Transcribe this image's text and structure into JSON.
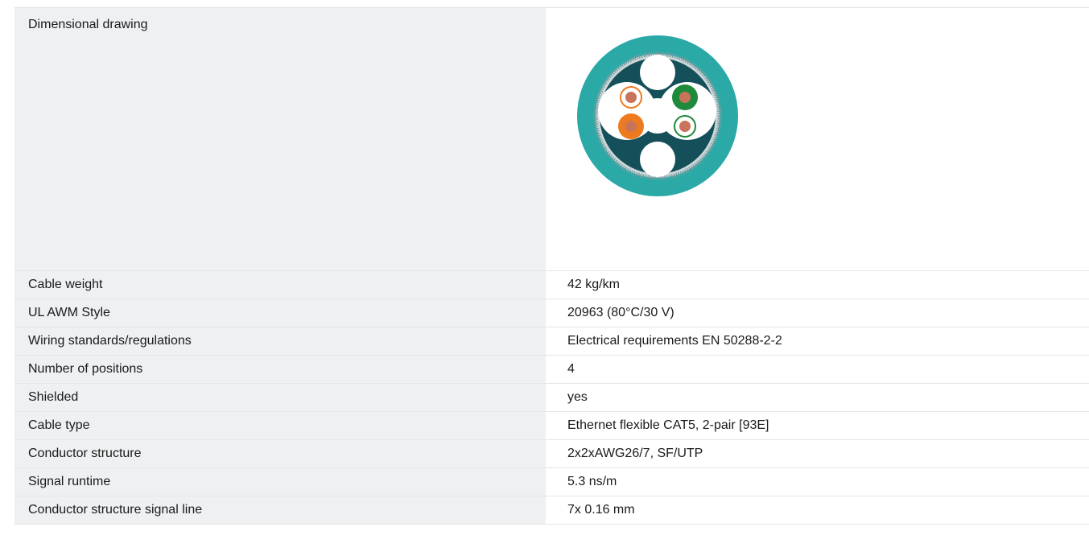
{
  "specs": {
    "drawing_label": "Dimensional drawing",
    "rows": [
      {
        "label": "Cable weight",
        "value": "42 kg/km"
      },
      {
        "label": "UL AWM Style",
        "value": "20963 (80°C/30 V)"
      },
      {
        "label": "Wiring standards/regulations",
        "value": "Electrical requirements EN 50288-2-2"
      },
      {
        "label": "Number of positions",
        "value": "4"
      },
      {
        "label": "Shielded",
        "value": "yes"
      },
      {
        "label": "Cable type",
        "value": "Ethernet flexible CAT5, 2-pair [93E]"
      },
      {
        "label": "Conductor structure",
        "value": "2x2xAWG26/7, SF/UTP"
      },
      {
        "label": "Signal runtime",
        "value": "5.3 ns/m"
      },
      {
        "label": "Conductor structure signal line",
        "value": "7x 0.16 mm"
      }
    ]
  },
  "colors": {
    "outer_jacket": "#2aa9a7",
    "inner_core": "#15505a",
    "shield_braid": "#cfd8d9",
    "filler": "#ffffff",
    "orange_conductor": "#ee7a1f",
    "green_conductor": "#1f8a3b",
    "copper": "#c9735b"
  },
  "icons": {
    "cable_cross_section": "cable-cross-section-icon"
  }
}
